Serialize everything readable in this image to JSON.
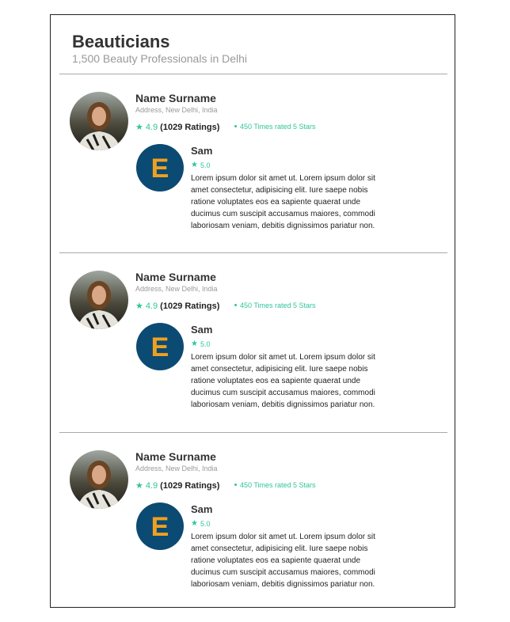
{
  "header": {
    "title": "Beauticians",
    "subtitle": "1,500 Beauty Professionals in Delhi"
  },
  "listings": [
    {
      "name": "Name Surname",
      "address": "Address, New Delhi, India",
      "rating": "4.9",
      "ratings_count": "(1029 Ratings)",
      "rated_text": "450 Times rated 5 Stars",
      "review": {
        "reviewer": "Sam",
        "reviewer_initial": "E",
        "rating": "5.0",
        "text": "Lorem ipsum dolor sit amet ut. Lorem ipsum dolor sit amet consectetur, adipisicing elit. Iure saepe nobis ratione voluptates eos ea sapiente quaerat unde ducimus cum suscipit accusamus maiores, commodi laboriosam veniam, debitis dignissimos pariatur non."
      }
    },
    {
      "name": "Name Surname",
      "address": "Address, New Delhi, India",
      "rating": "4.9",
      "ratings_count": "(1029 Ratings)",
      "rated_text": "450 Times rated 5 Stars",
      "review": {
        "reviewer": "Sam",
        "reviewer_initial": "E",
        "rating": "5.0",
        "text": "Lorem ipsum dolor sit amet ut. Lorem ipsum dolor sit amet consectetur, adipisicing elit. Iure saepe nobis ratione voluptates eos ea sapiente quaerat unde ducimus cum suscipit accusamus maiores, commodi laboriosam veniam, debitis dignissimos pariatur non."
      }
    },
    {
      "name": "Name Surname",
      "address": "Address, New Delhi, India",
      "rating": "4.9",
      "ratings_count": "(1029 Ratings)",
      "rated_text": "450 Times rated 5 Stars",
      "review": {
        "reviewer": "Sam",
        "reviewer_initial": "E",
        "rating": "5.0",
        "text": "Lorem ipsum dolor sit amet ut. Lorem ipsum dolor sit amet consectetur, adipisicing elit. Iure saepe nobis ratione voluptates eos ea sapiente quaerat unde ducimus cum suscipit accusamus maiores, commodi laboriosam veniam, debitis dignissimos pariatur non."
      }
    }
  ],
  "icons": {
    "star": "star-icon"
  },
  "colors": {
    "accent": "#2fc59a",
    "reviewer_avatar_bg": "#0b4a72",
    "reviewer_initial": "#f0a020"
  }
}
